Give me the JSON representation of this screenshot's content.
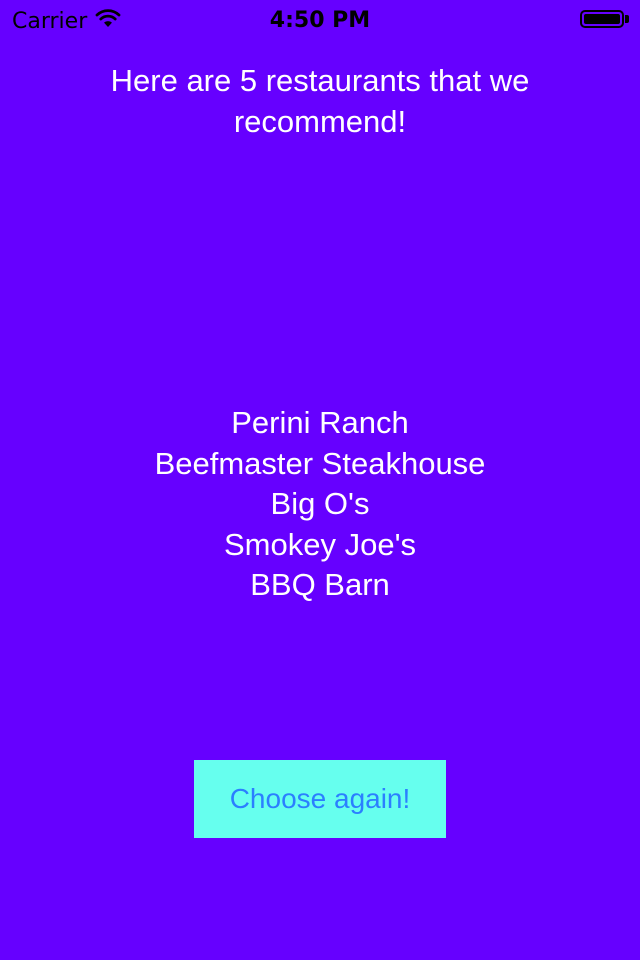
{
  "status_bar": {
    "carrier": "Carrier",
    "time": "4:50 PM",
    "icons": {
      "signal": "wifi-icon",
      "battery": "battery-icon"
    }
  },
  "heading": "Here are 5 restaurants that we recommend!",
  "restaurants": [
    "Perini Ranch",
    "Beefmaster Steakhouse",
    "Big O's",
    "Smokey Joe's",
    "BBQ Barn"
  ],
  "choose_button": {
    "label": "Choose again!"
  },
  "colors": {
    "background": "#6600ff",
    "text": "#ffffff",
    "button_background": "#66ffee",
    "button_text": "#2b7fff"
  }
}
